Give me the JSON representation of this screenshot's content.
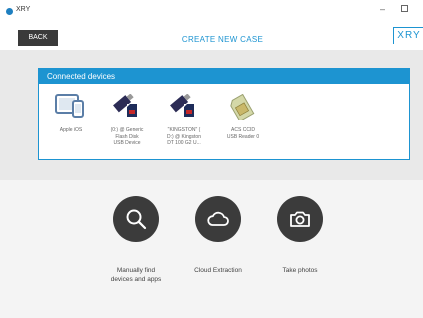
{
  "window": {
    "title": "XRY"
  },
  "header": {
    "back_label": "BACK",
    "title": "CREATE NEW CASE",
    "logo": "XRY"
  },
  "devices": {
    "header": "Connected devices",
    "items": [
      {
        "label": "Apple iOS",
        "icon": "tablet-phone-icon"
      },
      {
        "label": "(0:) @ Generic\nFlash Disk\nUSB Device",
        "icon": "sd-card-usb-icon"
      },
      {
        "label": "\"KINGSTON\" (\nD:) @ Kingston\nDT 100 G2 U...",
        "icon": "sd-card-usb-icon"
      },
      {
        "label": "ACS CCID\nUSB Reader 0",
        "icon": "sim-card-icon"
      }
    ]
  },
  "actions": [
    {
      "label": "Manually find\ndevices and apps",
      "icon": "search-icon"
    },
    {
      "label": "Cloud Extraction",
      "icon": "cloud-icon"
    },
    {
      "label": "Take photos",
      "icon": "camera-icon"
    }
  ],
  "colors": {
    "accent": "#1d94d1",
    "dark": "#3b3b3b"
  }
}
